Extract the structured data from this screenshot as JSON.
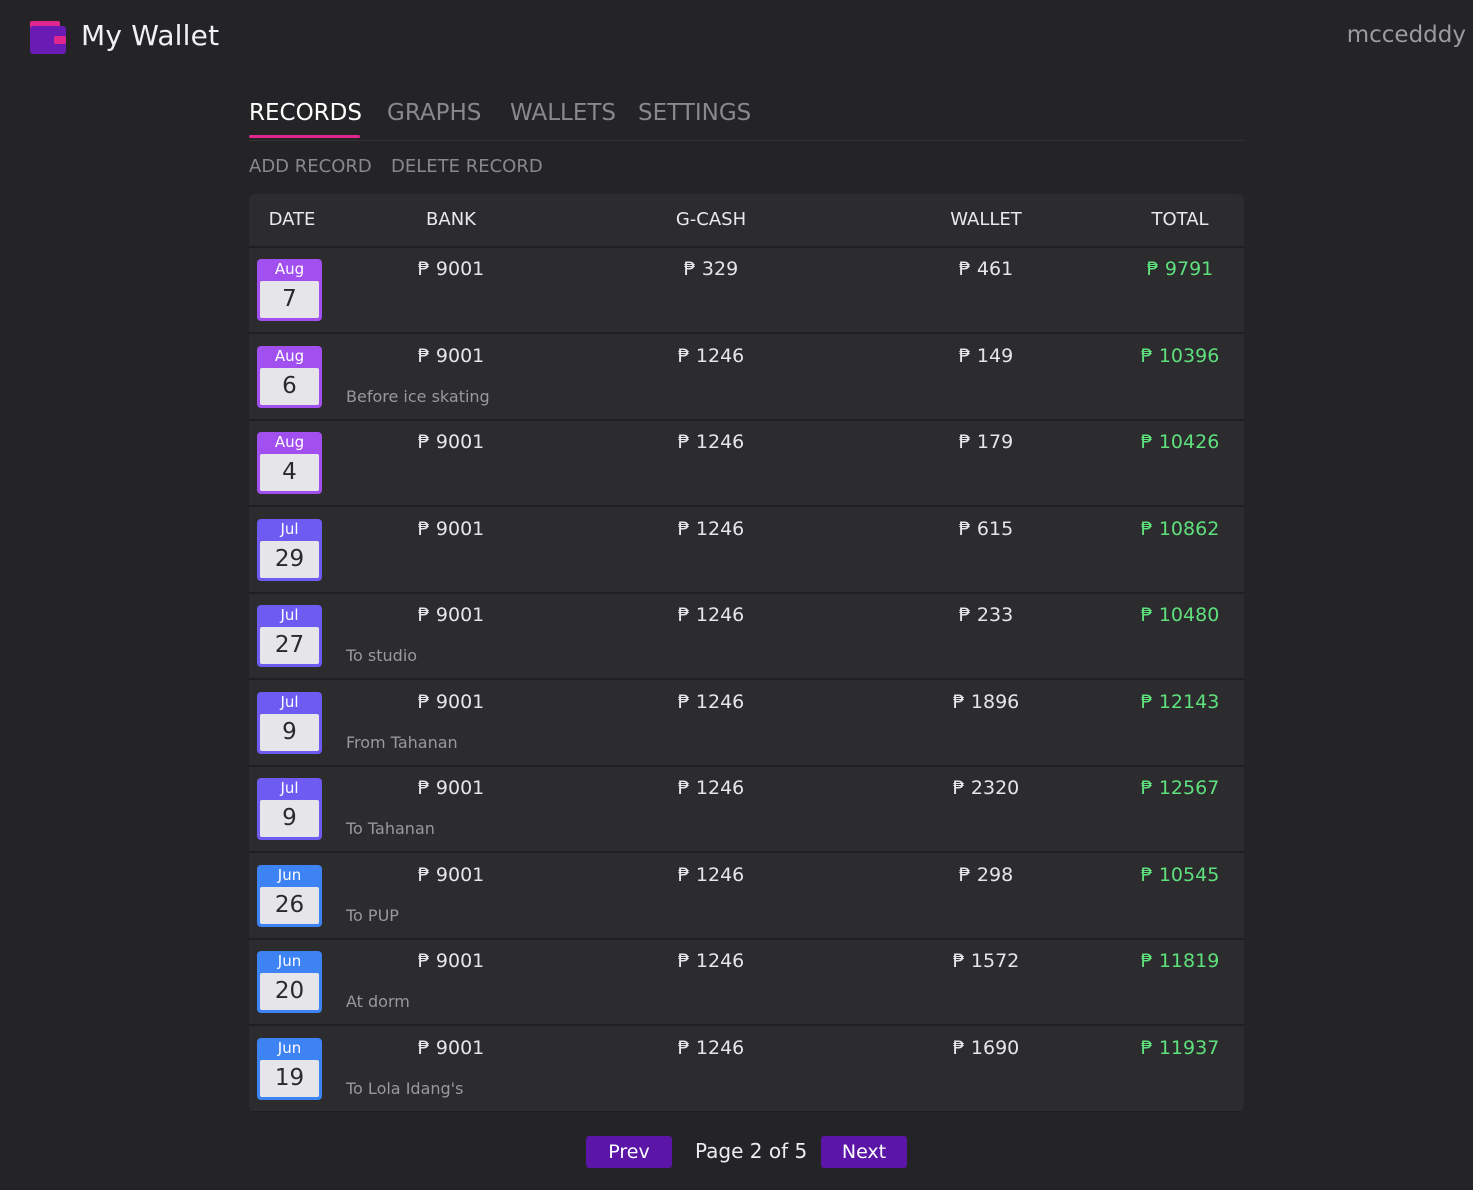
{
  "header": {
    "title": "My Wallet",
    "username": "mccedddy"
  },
  "tabs": [
    {
      "label": "RECORDS",
      "active": true
    },
    {
      "label": "GRAPHS",
      "active": false
    },
    {
      "label": "WALLETS",
      "active": false
    },
    {
      "label": "SETTINGS",
      "active": false
    }
  ],
  "actions": {
    "add": "ADD RECORD",
    "delete": "DELETE RECORD"
  },
  "table": {
    "columns": [
      "DATE",
      "BANK",
      "G-CASH",
      "WALLET",
      "TOTAL"
    ],
    "rows": [
      {
        "month": "Aug",
        "day": "7",
        "bank": "₱ 9001",
        "gcash": "₱ 329",
        "wallet": "₱ 461",
        "total": "₱ 9791",
        "note": ""
      },
      {
        "month": "Aug",
        "day": "6",
        "bank": "₱ 9001",
        "gcash": "₱ 1246",
        "wallet": "₱ 149",
        "total": "₱ 10396",
        "note": "Before ice skating"
      },
      {
        "month": "Aug",
        "day": "4",
        "bank": "₱ 9001",
        "gcash": "₱ 1246",
        "wallet": "₱ 179",
        "total": "₱ 10426",
        "note": ""
      },
      {
        "month": "Jul",
        "day": "29",
        "bank": "₱ 9001",
        "gcash": "₱ 1246",
        "wallet": "₱ 615",
        "total": "₱ 10862",
        "note": ""
      },
      {
        "month": "Jul",
        "day": "27",
        "bank": "₱ 9001",
        "gcash": "₱ 1246",
        "wallet": "₱ 233",
        "total": "₱ 10480",
        "note": "To studio"
      },
      {
        "month": "Jul",
        "day": "9",
        "bank": "₱ 9001",
        "gcash": "₱ 1246",
        "wallet": "₱ 1896",
        "total": "₱ 12143",
        "note": "From Tahanan"
      },
      {
        "month": "Jul",
        "day": "9",
        "bank": "₱ 9001",
        "gcash": "₱ 1246",
        "wallet": "₱ 2320",
        "total": "₱ 12567",
        "note": "To Tahanan"
      },
      {
        "month": "Jun",
        "day": "26",
        "bank": "₱ 9001",
        "gcash": "₱ 1246",
        "wallet": "₱ 298",
        "total": "₱ 10545",
        "note": "To PUP"
      },
      {
        "month": "Jun",
        "day": "20",
        "bank": "₱ 9001",
        "gcash": "₱ 1246",
        "wallet": "₱ 1572",
        "total": "₱ 11819",
        "note": "At dorm"
      },
      {
        "month": "Jun",
        "day": "19",
        "bank": "₱ 9001",
        "gcash": "₱ 1246",
        "wallet": "₱ 1690",
        "total": "₱ 11937",
        "note": "To Lola Idang's"
      }
    ]
  },
  "pagination": {
    "prev": "Prev",
    "info": "Page 2 of 5",
    "next": "Next"
  },
  "colors": {
    "background": "#242325",
    "accent_tab": "#e0278f",
    "button": "#5b16a8",
    "total_green": "#5ee07d",
    "month_aug": "#a24ff0",
    "month_jul": "#6e5cf2",
    "month_jun": "#3d83f4"
  }
}
